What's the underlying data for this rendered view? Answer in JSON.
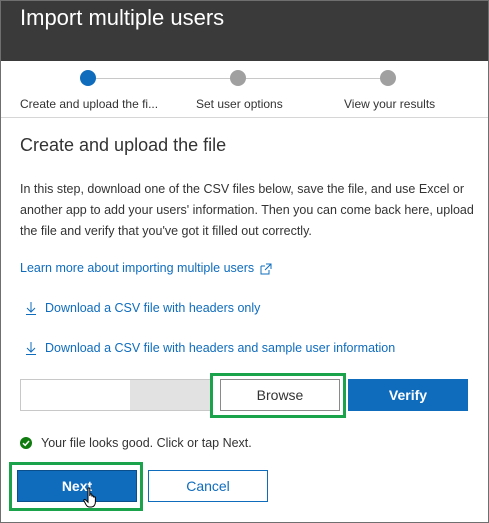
{
  "window": {
    "title": "Import multiple users"
  },
  "stepper": {
    "steps": [
      {
        "label": "Create and upload the fi...",
        "active": true
      },
      {
        "label": "Set user options",
        "active": false
      },
      {
        "label": "View your results",
        "active": false
      }
    ]
  },
  "main": {
    "section_title": "Create and upload the file",
    "intro": "In this step, download one of the CSV files below, save the file, and use Excel or another app to add your users' information. Then you can come back here, upload the file and verify that you've got it filled out correctly.",
    "learn_more_link": "Learn more about importing multiple users",
    "download_headers_link": "Download a CSV file with headers only",
    "download_sample_link": "Download a CSV file with headers and sample user information",
    "file_input_value": "",
    "browse_label": "Browse",
    "verify_label": "Verify",
    "status_text": "Your file looks good. Click or tap Next."
  },
  "footer": {
    "next_label": "Next",
    "cancel_label": "Cancel"
  },
  "colors": {
    "accent": "#0f6cbd",
    "header_bg": "#3a3a3a",
    "highlight": "#1aa34a",
    "success": "#107c10"
  },
  "icons": {
    "external": "external-link-icon",
    "download": "download-arrow-icon",
    "status": "check-circle-icon",
    "pointer": "hand-cursor-icon"
  }
}
